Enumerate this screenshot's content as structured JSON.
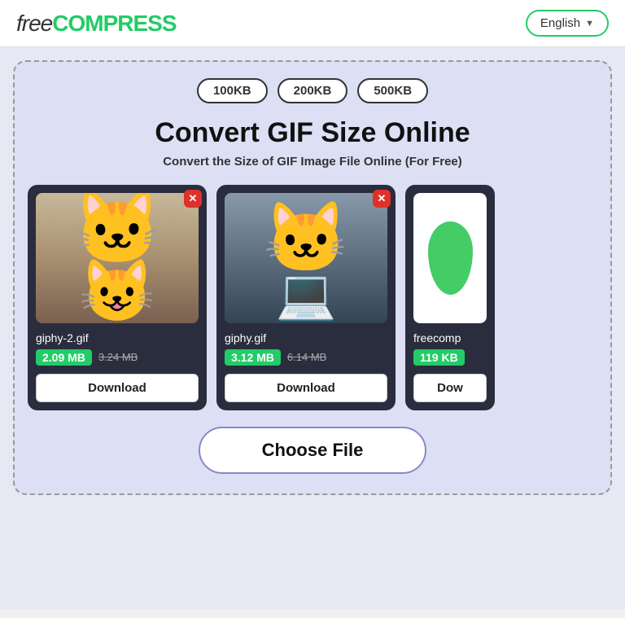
{
  "header": {
    "logo_free": "free",
    "logo_compress": "COMPRESS",
    "lang_label": "English",
    "lang_arrow": "▼"
  },
  "size_badges": [
    "100KB",
    "200KB",
    "500KB"
  ],
  "main_title": "Convert GIF Size Online",
  "main_subtitle": "Convert the Size of GIF Image File Online (For Free)",
  "cards": [
    {
      "filename": "giphy-2.gif",
      "compressed_size": "2.09 MB",
      "original_size": "3.24 MB",
      "download_label": "Download",
      "type": "cat1"
    },
    {
      "filename": "giphy.gif",
      "compressed_size": "3.12 MB",
      "original_size": "6.14 MB",
      "download_label": "Download",
      "type": "cat2"
    },
    {
      "filename": "freecomp",
      "compressed_size": "119 KB",
      "original_size": "",
      "download_label": "Dow",
      "type": "cat3"
    }
  ],
  "choose_file_label": "Choose File"
}
